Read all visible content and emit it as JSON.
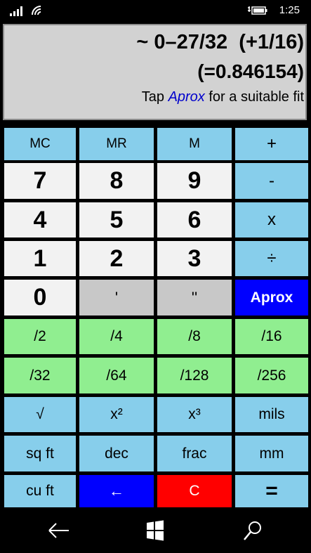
{
  "statusbar": {
    "time": "1:25"
  },
  "display": {
    "result_line": "~ 0–27/32  (+1/16)",
    "decimal_line": "(=0.846154)",
    "hint_prefix": "Tap ",
    "hint_keyword": "Aprox",
    "hint_suffix": " for a suitable fit"
  },
  "keys": {
    "mc": "MC",
    "mr": "MR",
    "m": "M",
    "plus": "+",
    "seven": "7",
    "eight": "8",
    "nine": "9",
    "minus": "-",
    "four": "4",
    "five": "5",
    "six": "6",
    "multiply": "x",
    "one": "1",
    "two": "2",
    "three": "3",
    "divide": "÷",
    "zero": "0",
    "feet": "'",
    "inches": "''",
    "aprox": "Aprox",
    "half": "/2",
    "quarter": "/4",
    "eighth": "/8",
    "sixteenth": "/16",
    "thirty_second": "/32",
    "sixty_fourth": "/64",
    "one_twenty_eighth": "/128",
    "two_fifty_sixth": "/256",
    "sqrt": "√",
    "square": "x²",
    "cube": "x³",
    "mils": "mils",
    "sq_ft": "sq ft",
    "dec": "dec",
    "frac": "frac",
    "mm": "mm",
    "cu_ft": "cu ft",
    "backspace": "←",
    "clear": "C",
    "equals": "="
  },
  "icons": [
    "cellular-signal-icon",
    "wifi-icon",
    "battery-icon",
    "back-arrow-icon",
    "windows-icon",
    "search-icon"
  ]
}
